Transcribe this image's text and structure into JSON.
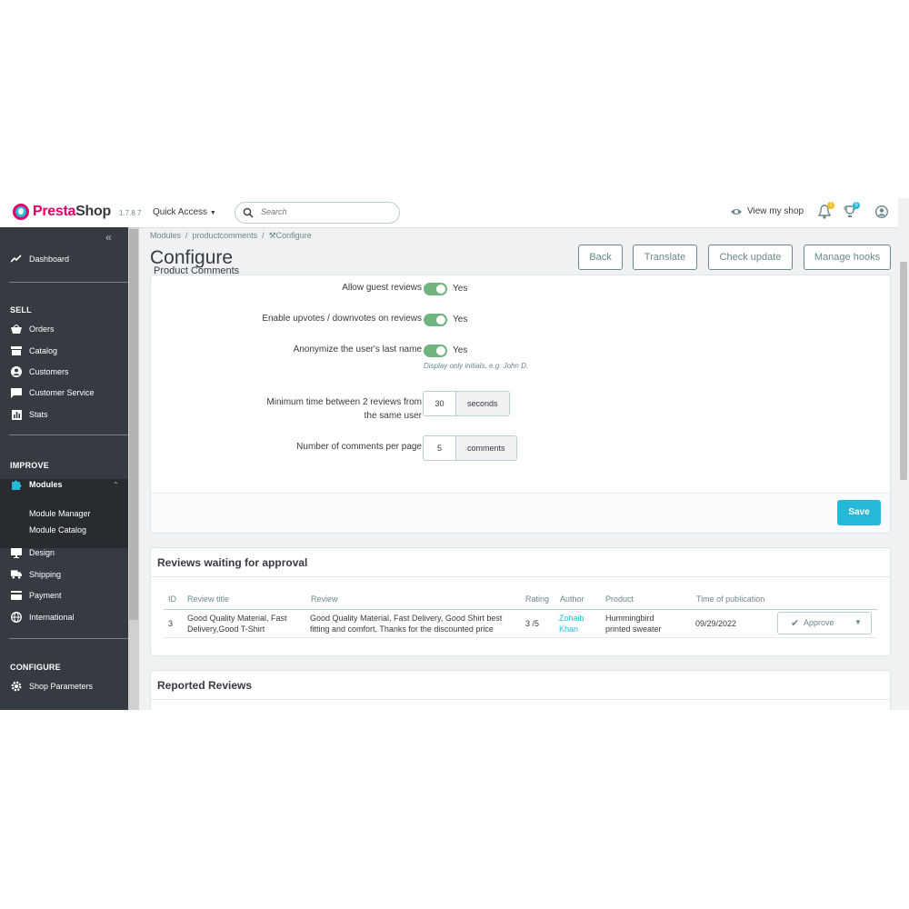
{
  "header": {
    "brand_a": "Presta",
    "brand_b": "Shop",
    "version": "1.7.8.7",
    "quick_access": "Quick Access",
    "search_placeholder": "Search",
    "view_shop": "View my shop",
    "notif_count_1": "1",
    "notif_count_2": "5"
  },
  "sidebar": {
    "dashboard": "Dashboard",
    "sell": "SELL",
    "orders": "Orders",
    "catalog": "Catalog",
    "customers": "Customers",
    "customer_service": "Customer Service",
    "stats": "Stats",
    "improve": "IMPROVE",
    "modules": "Modules",
    "module_manager": "Module Manager",
    "module_catalog": "Module Catalog",
    "design": "Design",
    "shipping": "Shipping",
    "payment": "Payment",
    "international": "International",
    "configure": "CONFIGURE",
    "shop_parameters": "Shop Parameters"
  },
  "breadcrumb": {
    "a": "Modules",
    "b": "productcomments",
    "c": "Configure"
  },
  "page": {
    "title": "Configure",
    "subtitle": "Product Comments",
    "buttons": {
      "back": "Back",
      "translate": "Translate",
      "check_update": "Check update",
      "manage_hooks": "Manage hooks"
    }
  },
  "settings": {
    "guest_label": "Allow guest reviews",
    "guest_value": "Yes",
    "votes_label": "Enable upvotes / downvotes on reviews",
    "votes_value": "Yes",
    "anon_label": "Anonymize the user's last name",
    "anon_value": "Yes",
    "anon_help": "Display only initials, e.g. John D.",
    "min_time_label_1": "Minimum time between 2 reviews from",
    "min_time_label_2": "the same user",
    "min_time_value": "30",
    "min_time_unit": "seconds",
    "per_page_label": "Number of comments per page",
    "per_page_value": "5",
    "per_page_unit": "comments",
    "save": "Save"
  },
  "waiting": {
    "title": "Reviews waiting for approval",
    "columns": [
      "ID",
      "Review title",
      "Review",
      "Rating",
      "Author",
      "Product",
      "Time of publication"
    ],
    "row": {
      "id": "3",
      "title_1": "Good Quality Material, Fast",
      "title_2": "Delivery,Good T-Shirt",
      "review_1": "Good Quality Material, Fast Delivery, Good Shirt best",
      "review_2": "fitting and comfort, Thanks for the discounted price",
      "rating": "3 /5",
      "author_1": "Zohaib",
      "author_2": "Khan",
      "product_1": "Hummingbird",
      "product_2": "printed sweater",
      "time": "09/29/2022",
      "action": "Approve"
    }
  },
  "reported": {
    "title": "Reported Reviews"
  }
}
